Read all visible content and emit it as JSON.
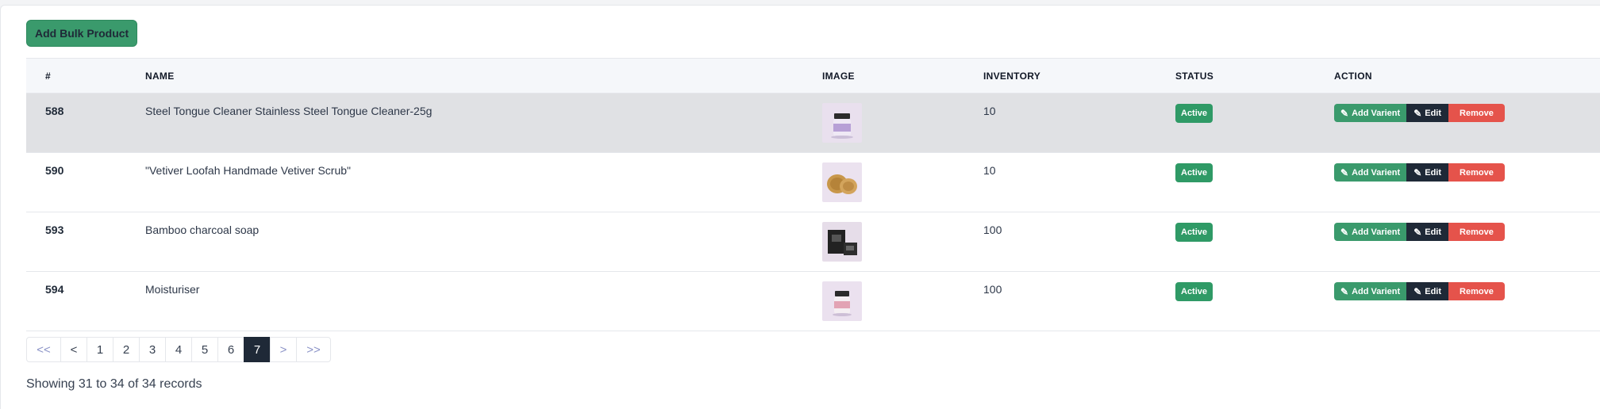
{
  "toolbar": {
    "add_bulk_label": "Add Bulk Product"
  },
  "table": {
    "headers": [
      "#",
      "NAME",
      "IMAGE",
      "INVENTORY",
      "STATUS",
      "ACTION"
    ],
    "rows": [
      {
        "id": "588",
        "name": "Steel Tongue Cleaner Stainless Steel Tongue Cleaner-25g",
        "image": "jar-lavender",
        "inventory": "10",
        "status": "Active"
      },
      {
        "id": "590",
        "name": "\"Vetiver Loofah Handmade Vetiver Scrub\"",
        "image": "loofah-scrubs",
        "inventory": "10",
        "status": "Active"
      },
      {
        "id": "593",
        "name": "Bamboo charcoal soap",
        "image": "soap-box-black",
        "inventory": "100",
        "status": "Active"
      },
      {
        "id": "594",
        "name": "Moisturiser",
        "image": "jar-pink",
        "inventory": "100",
        "status": "Active"
      }
    ],
    "actions": {
      "add_varient": "Add Varient",
      "edit": "Edit",
      "remove": "Remove"
    }
  },
  "pagination": {
    "first": "<<",
    "prev": "<",
    "pages": [
      "1",
      "2",
      "3",
      "4",
      "5",
      "6",
      "7"
    ],
    "current": "7",
    "next": ">",
    "last": ">>"
  },
  "records_text": "Showing 31 to 34 of 34 records",
  "colors": {
    "primary_green": "#3a9a6c",
    "status_green": "#2f9a66",
    "dark": "#1f2937",
    "danger": "#e5534b",
    "row_highlight": "#e0e1e4"
  }
}
